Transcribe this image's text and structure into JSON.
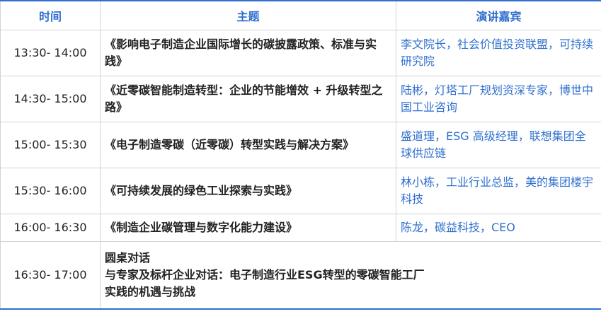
{
  "header": {
    "time": "时间",
    "topic": "主题",
    "speaker": "演讲嘉宾"
  },
  "rows": [
    {
      "time": "13:30- 14:00",
      "topic": "《影响电子制造企业国际增长的碳披露政策、标准与实践》",
      "speaker": "李文院长，社会价值投资联盟，可持续研究院"
    },
    {
      "time": "14:30- 15:00",
      "topic": "《近零碳智能制造转型：企业的节能增效 + 升级转型之路》",
      "speaker": "陆彬，灯塔工厂规划资深专家，博世中国工业咨询"
    },
    {
      "time": "15:00- 15:30",
      "topic": "《电子制造零碳（近零碳）转型实践与解决方案》",
      "speaker": "盛道理，ESG 高级经理，联想集团全球供应链"
    },
    {
      "time": "15:30- 16:00",
      "topic": "《可持续发展的绿色工业探索与实践》",
      "speaker": "林小栋，工业行业总监，美的集团楼宇科技"
    },
    {
      "time": "16:00- 16:30",
      "topic": "《制造企业碳管理与数字化能力建设》",
      "speaker": "陈龙，碳益科技，CEO"
    }
  ],
  "roundtable": {
    "time": "16:30- 17:00",
    "line1": "圆桌对话",
    "line2": "与专家及标杆企业对话：电子制造行业ESG转型的零碳智能工厂",
    "line3": "实践的机遇与挑战"
  }
}
